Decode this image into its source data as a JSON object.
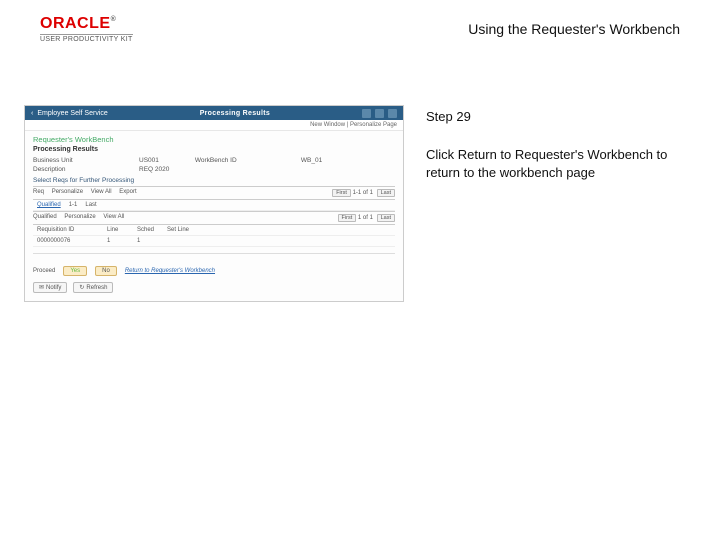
{
  "header": {
    "brand": "ORACLE",
    "subbrand": "USER PRODUCTIVITY KIT",
    "title": "Using the Requester's Workbench"
  },
  "step": {
    "label": "Step 29"
  },
  "instruction": {
    "text": "Click Return to Requester's Workbench to return to the workbench page"
  },
  "mini": {
    "bar_back": "Employee Self Service",
    "bar_center": "Processing Results",
    "subbar": "New Window | Personalize Page",
    "h1": "Requester's WorkBench",
    "h2": "Processing Results",
    "kv": [
      {
        "k": "Business Unit",
        "v": "US001",
        "k2": "WorkBench ID",
        "v2": "WB_01"
      },
      {
        "k": "Description",
        "v": "REQ 2020"
      },
      {
        "k": "Select Reqs for Further Processing",
        "v": ""
      }
    ],
    "grid": {
      "head_left": [
        "Req",
        "Personalize",
        "View All",
        "Export"
      ],
      "head_right": [
        "First",
        "1-1 of 1",
        "Last"
      ],
      "row1": [
        "Qualified",
        "",
        "1-1",
        "Last"
      ],
      "row2_left": [
        "Qualified",
        "Personalize",
        "View All"
      ],
      "row2_right": [
        "First",
        "1 of 1",
        "Last"
      ],
      "row3": [
        "Requisition ID",
        "Line",
        "Sched",
        "Set Line"
      ],
      "row4": [
        "0000000076",
        "1",
        "1",
        ""
      ]
    },
    "footer": {
      "label": "Proceed",
      "yes": "Yes",
      "no": "No",
      "return": "Return to Requester's Workbench",
      "notify": "Notify",
      "refresh": "Refresh"
    }
  }
}
